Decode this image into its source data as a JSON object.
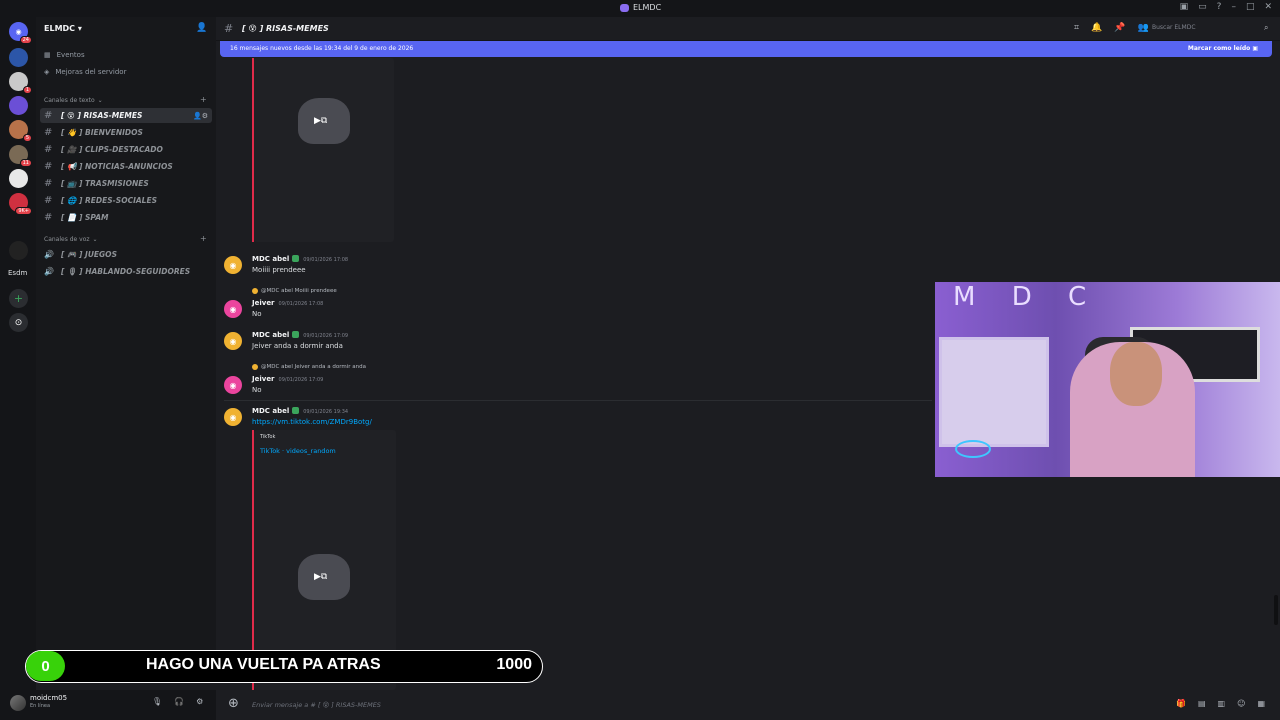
{
  "titlebar": {
    "title": "ELMDC"
  },
  "rail": {
    "servers": [
      {
        "label": "",
        "badge": "24"
      },
      {
        "label": "",
        "badge": ""
      },
      {
        "label": "",
        "badge": "1"
      },
      {
        "label": "",
        "badge": ""
      },
      {
        "label": "",
        "badge": "5"
      },
      {
        "label": "",
        "badge": "11"
      },
      {
        "label": "",
        "badge": ""
      },
      {
        "label": "",
        "badge": "9K+"
      },
      {
        "label": "",
        "badge": ""
      }
    ],
    "esdm": "Esdm"
  },
  "sidebar": {
    "guild": "ELMDC",
    "events": "Eventos",
    "boosts": "Mejoras del servidor",
    "text_category": "Canales de texto",
    "voice_category": "Canales de voz",
    "channels": [
      "[ 😵 ] RISAS-MEMES",
      "[ 👋 ] BIENVENIDOS",
      "[ 🎥 ] CLIPS-DESTACADO",
      "[ 📢 ] NOTICIAS-ANUNCIOS",
      "[ 📺 ] TRASMISIONES",
      "[ 🌐 ] REDES-SOCIALES",
      "[ 📄 ] SPAM"
    ],
    "voice": [
      "[ 🎮 ] JUEGOS",
      "[ 🎙 ] HABLANDO-SEGUIDORES"
    ]
  },
  "user": {
    "name": "moidcm05",
    "status": "En línea"
  },
  "header": {
    "channel": "[ 😵 ] RISAS-MEMES",
    "search_placeholder": "Buscar ELMDC"
  },
  "banner": {
    "text": "16 mensajes nuevos desde las 19:34 del 9 de enero de 2026",
    "mark": "Marcar como leído"
  },
  "messages": [
    {
      "author": "MDC abel",
      "time": "09/01/2026 17:08",
      "text": "Moiiii prendeee"
    },
    {
      "reply": "@MDC abel Moiiii prendeee",
      "author": "Jeiver",
      "time": "09/01/2026 17:08",
      "text": "No"
    },
    {
      "author": "MDC abel",
      "time": "09/01/2026 17:09",
      "text": "Jeiver anda a dormir anda"
    },
    {
      "reply": "@MDC abel Jeiver anda a dormir anda",
      "author": "Jeiver",
      "time": "09/01/2026 17:09",
      "text": "No"
    },
    {
      "author": "MDC abel",
      "time": "09/01/2026 19:34",
      "text": "https://vm.tiktok.com/ZMDr9Botg/",
      "embed_provider": "TikTok",
      "embed_title": "TikTok · videos_random"
    }
  ],
  "overlay": {
    "count": "0",
    "text": "HAGO UNA VUELTA PA ATRAS",
    "goal": "1000"
  },
  "webcam": {
    "letters": "M D C"
  },
  "composer": {
    "placeholder": "Enviar mensaje a # [ 😵 ] RISAS-MEMES"
  }
}
